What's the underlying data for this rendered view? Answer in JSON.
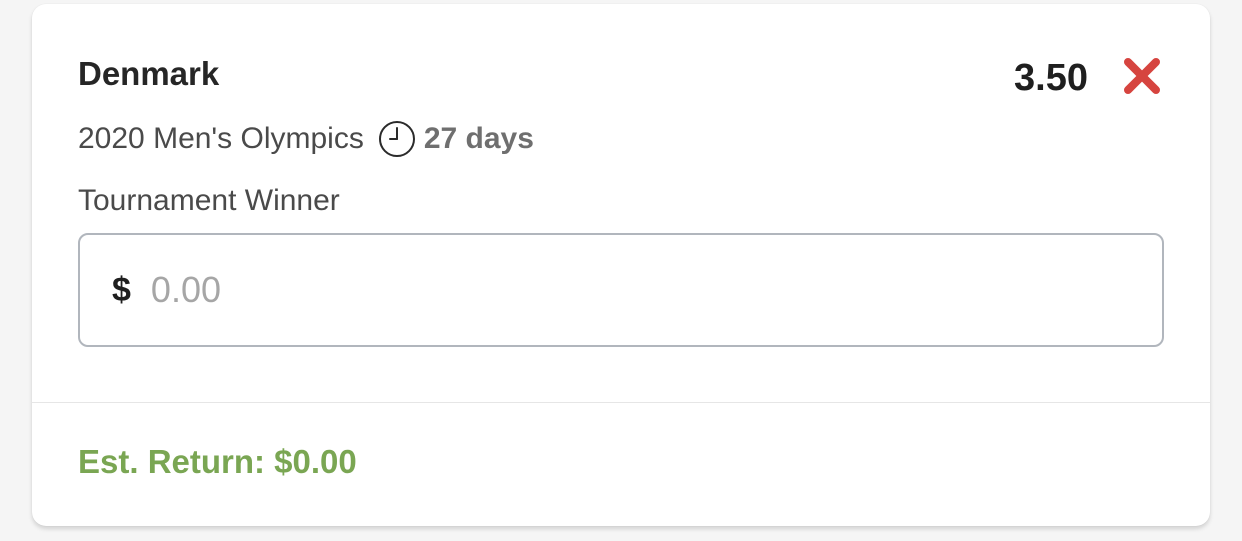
{
  "bet": {
    "selection": "Denmark",
    "odds": "3.50",
    "event": "2020 Men's Olympics",
    "countdown": "27 days",
    "market": "Tournament Winner"
  },
  "stake": {
    "currency_symbol": "$",
    "value": "",
    "placeholder": "0.00"
  },
  "footer": {
    "est_return": "Est. Return: $0.00"
  },
  "icons": {
    "remove": "close-icon",
    "countdown": "clock-icon"
  },
  "colors": {
    "remove_icon": "#d6443f",
    "est_return": "#7aa653",
    "input_border": "#b1b6bd"
  }
}
